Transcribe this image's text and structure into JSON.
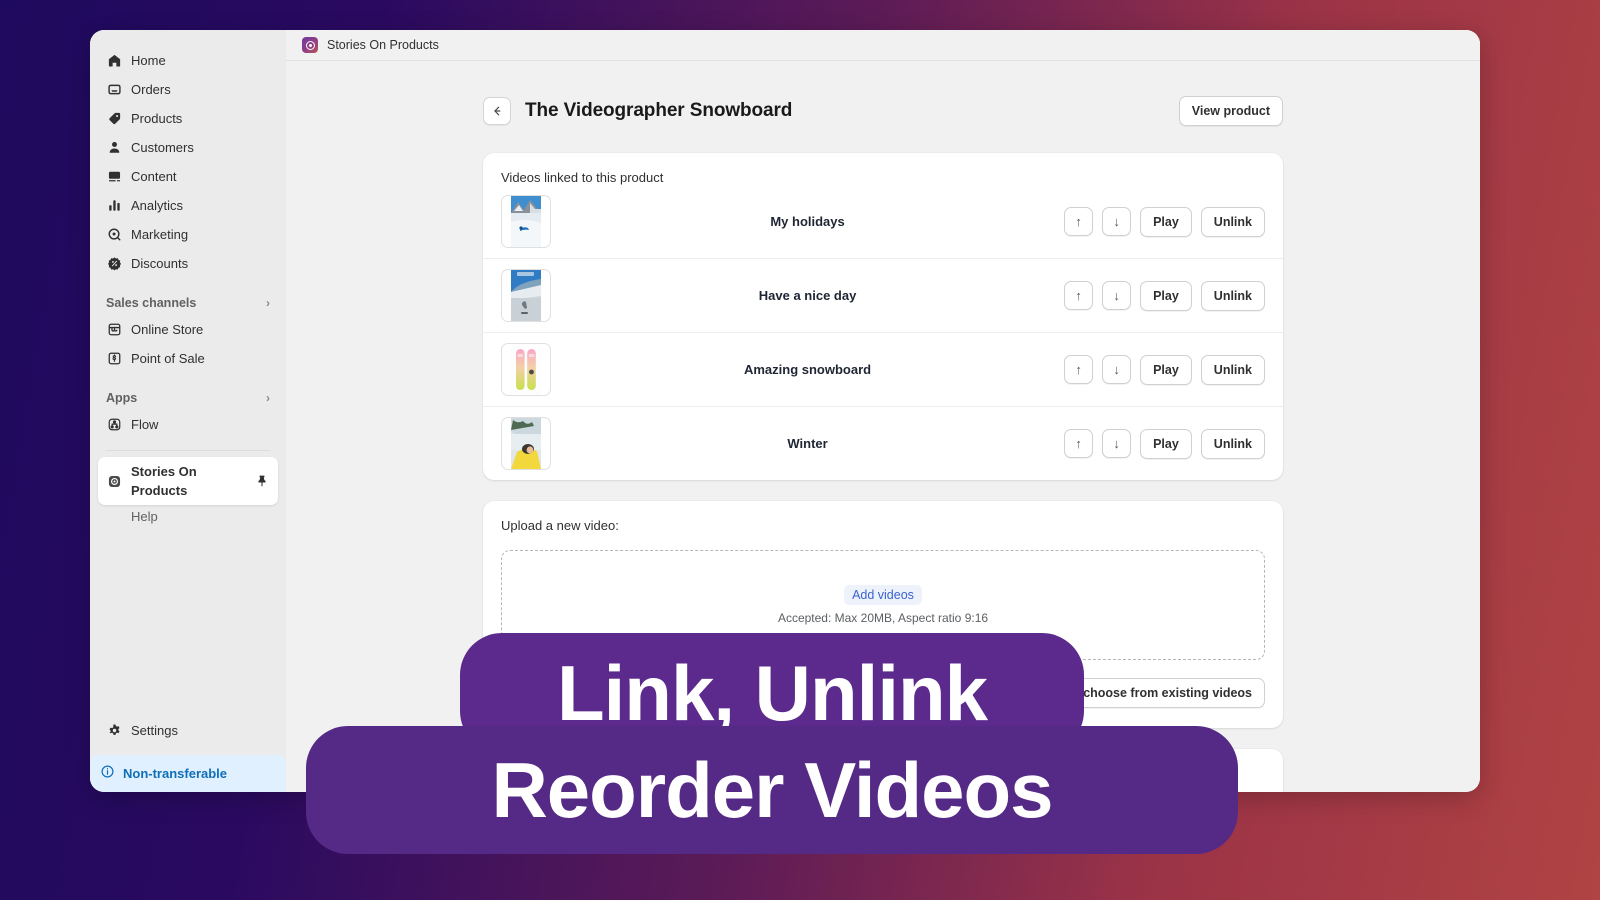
{
  "window": {
    "topbar": {
      "app_title": "Stories On Products",
      "app_icon": "stories-app-icon"
    }
  },
  "sidebar": {
    "items": [
      {
        "label": "Home",
        "icon": "home-icon"
      },
      {
        "label": "Orders",
        "icon": "orders-inbox-icon"
      },
      {
        "label": "Products",
        "icon": "product-tag-icon"
      },
      {
        "label": "Customers",
        "icon": "customer-person-icon"
      },
      {
        "label": "Content",
        "icon": "content-image-icon"
      },
      {
        "label": "Analytics",
        "icon": "analytics-bars-icon"
      },
      {
        "label": "Marketing",
        "icon": "marketing-target-icon"
      },
      {
        "label": "Discounts",
        "icon": "discount-badge-icon"
      }
    ],
    "sections": [
      {
        "title": "Sales channels",
        "chevron": "›",
        "items": [
          {
            "label": "Online Store",
            "icon": "storefront-icon"
          },
          {
            "label": "Point of Sale",
            "icon": "point-of-sale-icon"
          }
        ]
      },
      {
        "title": "Apps",
        "chevron": "›",
        "items": [
          {
            "label": "Flow",
            "icon": "flow-icon"
          }
        ]
      }
    ],
    "active_app": {
      "label": "Stories On Products",
      "icon": "stories-app-icon",
      "pin_icon": "pin-icon"
    },
    "sub_item": {
      "label": "Help"
    },
    "settings": {
      "label": "Settings",
      "icon": "gear-icon"
    },
    "status_banner": {
      "label": "Non-transferable",
      "icon": "info-circle-icon",
      "bg": "#e0f0ff",
      "fg": "#0f6fb8"
    }
  },
  "page": {
    "back_icon": "arrow-left-icon",
    "title": "The Videographer Snowboard",
    "view_product_label": "View product"
  },
  "videos_card": {
    "label": "Videos linked to this product",
    "buttons": {
      "move_up_icon": "arrow-up-icon",
      "move_up_glyph": "↑",
      "move_down_icon": "arrow-down-icon",
      "move_down_glyph": "↓",
      "play_label": "Play",
      "unlink_label": "Unlink"
    },
    "rows": [
      {
        "name": "My holidays",
        "thumb": "snowy-mountain-skier-thumbnail"
      },
      {
        "name": "Have a nice day",
        "thumb": "blue-sky-snow-slope-thumbnail"
      },
      {
        "name": "Amazing snowboard",
        "thumb": "pink-green-snowboards-thumbnail"
      },
      {
        "name": "Winter",
        "thumb": "yellow-jacket-snow-thumbnail"
      }
    ]
  },
  "upload_card": {
    "label": "Upload a new video:",
    "add_videos_label": "Add videos",
    "accepted_text": "Accepted: Max 20MB, Aspect ratio 9:16",
    "choose_existing_label": "Or choose from existing videos"
  },
  "overlay": {
    "line1": "Link, Unlink",
    "line2": "Reorder Videos",
    "color": "#5b2a8c"
  }
}
